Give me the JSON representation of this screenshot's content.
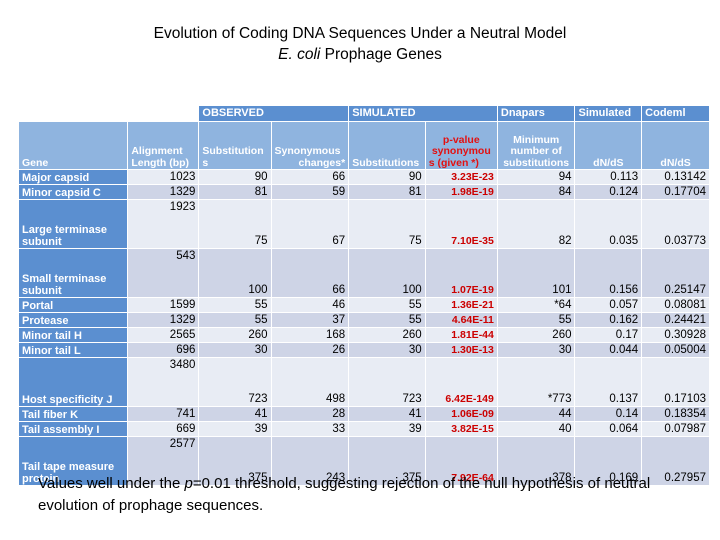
{
  "title": {
    "line1": "Evolution of Coding DNA Sequences Under a Neutral Model",
    "line2_italic": "E. coli",
    "line2_rest": " Prophage Genes"
  },
  "table": {
    "group_headers": [
      {
        "label": "OBSERVED",
        "span": 3
      },
      {
        "label": "SIMULATED",
        "span": 2
      },
      {
        "label": "Dnapars",
        "span": 1
      },
      {
        "label": "Simulated",
        "span": 1
      },
      {
        "label": "Codeml",
        "span": 1
      }
    ],
    "columns": [
      {
        "key": "gene",
        "label": "Gene"
      },
      {
        "key": "len",
        "label": "Alignment Length (bp)"
      },
      {
        "key": "subs",
        "label": "Substitutions"
      },
      {
        "key": "syn",
        "label": "Synonymous changes*"
      },
      {
        "key": "ssubs",
        "label": "Substitutions"
      },
      {
        "key": "pvalue",
        "label": "p-value synonymous (given *)"
      },
      {
        "key": "minsubs",
        "label": "Minimum number of substitutions"
      },
      {
        "key": "dnds_sim",
        "label": "dN/dS"
      },
      {
        "key": "dnds_cod",
        "label": "dN/dS"
      }
    ],
    "column_header_lines": {
      "gene": [
        "Gene"
      ],
      "len": [
        "Alignment",
        "Length (bp)"
      ],
      "subs": [
        "Substitution",
        "s"
      ],
      "syn": [
        "Synonymous",
        "changes*"
      ],
      "ssubs": [
        "Substitutions"
      ],
      "pvalue": [
        "p-value",
        "synonymou",
        "s (given *)"
      ],
      "minsubs": [
        "Minimum",
        "number of",
        "substitutions"
      ],
      "dnds_sim": [
        "dN/dS"
      ],
      "dnds_cod": [
        "dN/dS"
      ]
    },
    "rows": [
      {
        "gene": "Major capsid",
        "len": "1023",
        "subs": "90",
        "syn": "66",
        "ssubs": "90",
        "pvalue": "3.23E-23",
        "minsubs": "94",
        "dnds_sim": "0.113",
        "dnds_cod": "0.13142",
        "tall": false
      },
      {
        "gene": "Minor capsid C",
        "len": "1329",
        "subs": "81",
        "syn": "59",
        "ssubs": "81",
        "pvalue": "1.98E-19",
        "minsubs": "84",
        "dnds_sim": "0.124",
        "dnds_cod": "0.17704",
        "tall": false
      },
      {
        "gene": "Large terminase subunit",
        "len": "1923",
        "subs": "75",
        "syn": "67",
        "ssubs": "75",
        "pvalue": "7.10E-35",
        "minsubs": "82",
        "dnds_sim": "0.035",
        "dnds_cod": "0.03773",
        "tall": true
      },
      {
        "gene": "Small terminase subunit",
        "len": "543",
        "subs": "100",
        "syn": "66",
        "ssubs": "100",
        "pvalue": "1.07E-19",
        "minsubs": "101",
        "dnds_sim": "0.156",
        "dnds_cod": "0.25147",
        "tall": true
      },
      {
        "gene": "Portal",
        "len": "1599",
        "subs": "55",
        "syn": "46",
        "ssubs": "55",
        "pvalue": "1.36E-21",
        "minsubs": "*64",
        "dnds_sim": "0.057",
        "dnds_cod": "0.08081",
        "tall": false
      },
      {
        "gene": "Protease",
        "len": "1329",
        "subs": "55",
        "syn": "37",
        "ssubs": "55",
        "pvalue": "4.64E-11",
        "minsubs": "55",
        "dnds_sim": "0.162",
        "dnds_cod": "0.24421",
        "tall": false
      },
      {
        "gene": "Minor tail H",
        "len": "2565",
        "subs": "260",
        "syn": "168",
        "ssubs": "260",
        "pvalue": "1.81E-44",
        "minsubs": "260",
        "dnds_sim": "0.17",
        "dnds_cod": "0.30928",
        "tall": false
      },
      {
        "gene": "Minor tail L",
        "len": "696",
        "subs": "30",
        "syn": "26",
        "ssubs": "30",
        "pvalue": "1.30E-13",
        "minsubs": "30",
        "dnds_sim": "0.044",
        "dnds_cod": "0.05004",
        "tall": false
      },
      {
        "gene": "Host specificity J",
        "len": "3480",
        "subs": "723",
        "syn": "498",
        "ssubs": "723",
        "pvalue": "6.42E-149",
        "minsubs": "*773",
        "dnds_sim": "0.137",
        "dnds_cod": "0.17103",
        "tall": true
      },
      {
        "gene": "Tail fiber K",
        "len": "741",
        "subs": "41",
        "syn": "28",
        "ssubs": "41",
        "pvalue": "1.06E-09",
        "minsubs": "44",
        "dnds_sim": "0.14",
        "dnds_cod": "0.18354",
        "tall": false
      },
      {
        "gene": "Tail assembly I",
        "len": "669",
        "subs": "39",
        "syn": "33",
        "ssubs": "39",
        "pvalue": "3.82E-15",
        "minsubs": "40",
        "dnds_sim": "0.064",
        "dnds_cod": "0.07987",
        "tall": false
      },
      {
        "gene": "Tail tape measure protein",
        "len": "2577",
        "subs": "375",
        "syn": "243",
        "ssubs": "375",
        "pvalue": "7.92E-64",
        "minsubs": "378",
        "dnds_sim": "0.169",
        "dnds_cod": "0.27957",
        "tall": true
      }
    ]
  },
  "caption": {
    "part1": "Values well under the ",
    "italic": "p",
    "part2": "=0.01 threshold, suggesting rejection of the null hypothesis of neutral evolution of prophage sequences."
  },
  "colors": {
    "band": "#5b8fd0",
    "column_header": "#8fb4df",
    "gene_column": "#5b8fd0",
    "row_light": "#e8ecf4",
    "row_dark": "#ced4e6",
    "pvalue_text": "#cc0000",
    "header_accent_text": "#e31010"
  }
}
